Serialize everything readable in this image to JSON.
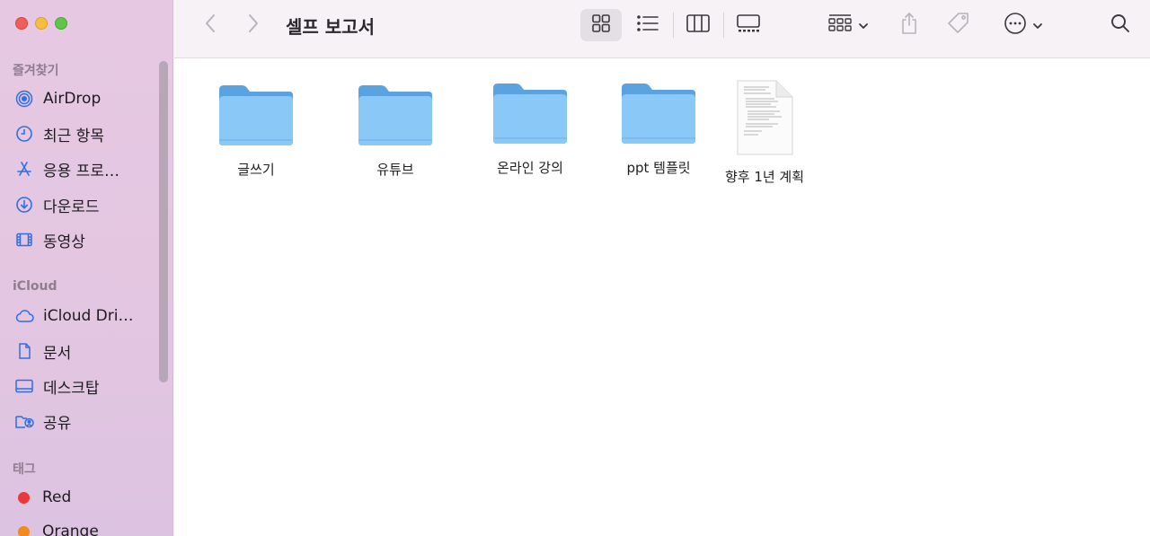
{
  "window": {
    "title": "셀프 보고서"
  },
  "sidebar": {
    "favorites_label": "즐겨찾기",
    "favorites": [
      {
        "label": "AirDrop",
        "icon": "airdrop-icon"
      },
      {
        "label": "최근 항목",
        "icon": "clock-icon"
      },
      {
        "label": "응용 프로…",
        "icon": "applications-icon"
      },
      {
        "label": "다운로드",
        "icon": "download-icon"
      },
      {
        "label": "동영상",
        "icon": "film-icon"
      }
    ],
    "icloud_label": "iCloud",
    "icloud": [
      {
        "label": "iCloud Dri…",
        "icon": "cloud-icon"
      },
      {
        "label": "문서",
        "icon": "document-icon"
      },
      {
        "label": "데스크탑",
        "icon": "desktop-icon"
      },
      {
        "label": "공유",
        "icon": "shared-folder-icon"
      }
    ],
    "tags_label": "태그",
    "tags": [
      {
        "label": "Red",
        "color": "#e9393a"
      },
      {
        "label": "Orange",
        "color": "#f28a1c"
      }
    ]
  },
  "files": [
    {
      "name": "글쓰기",
      "kind": "folder"
    },
    {
      "name": "유튜브",
      "kind": "folder"
    },
    {
      "name": "온라인 강의",
      "kind": "folder"
    },
    {
      "name": "ppt 템플릿",
      "kind": "folder"
    },
    {
      "name": "향후 1년 계획",
      "kind": "document"
    }
  ],
  "colors": {
    "accent": "#2f6fe0",
    "folder_front": "#89c8f7",
    "folder_back": "#5aa2e0"
  }
}
